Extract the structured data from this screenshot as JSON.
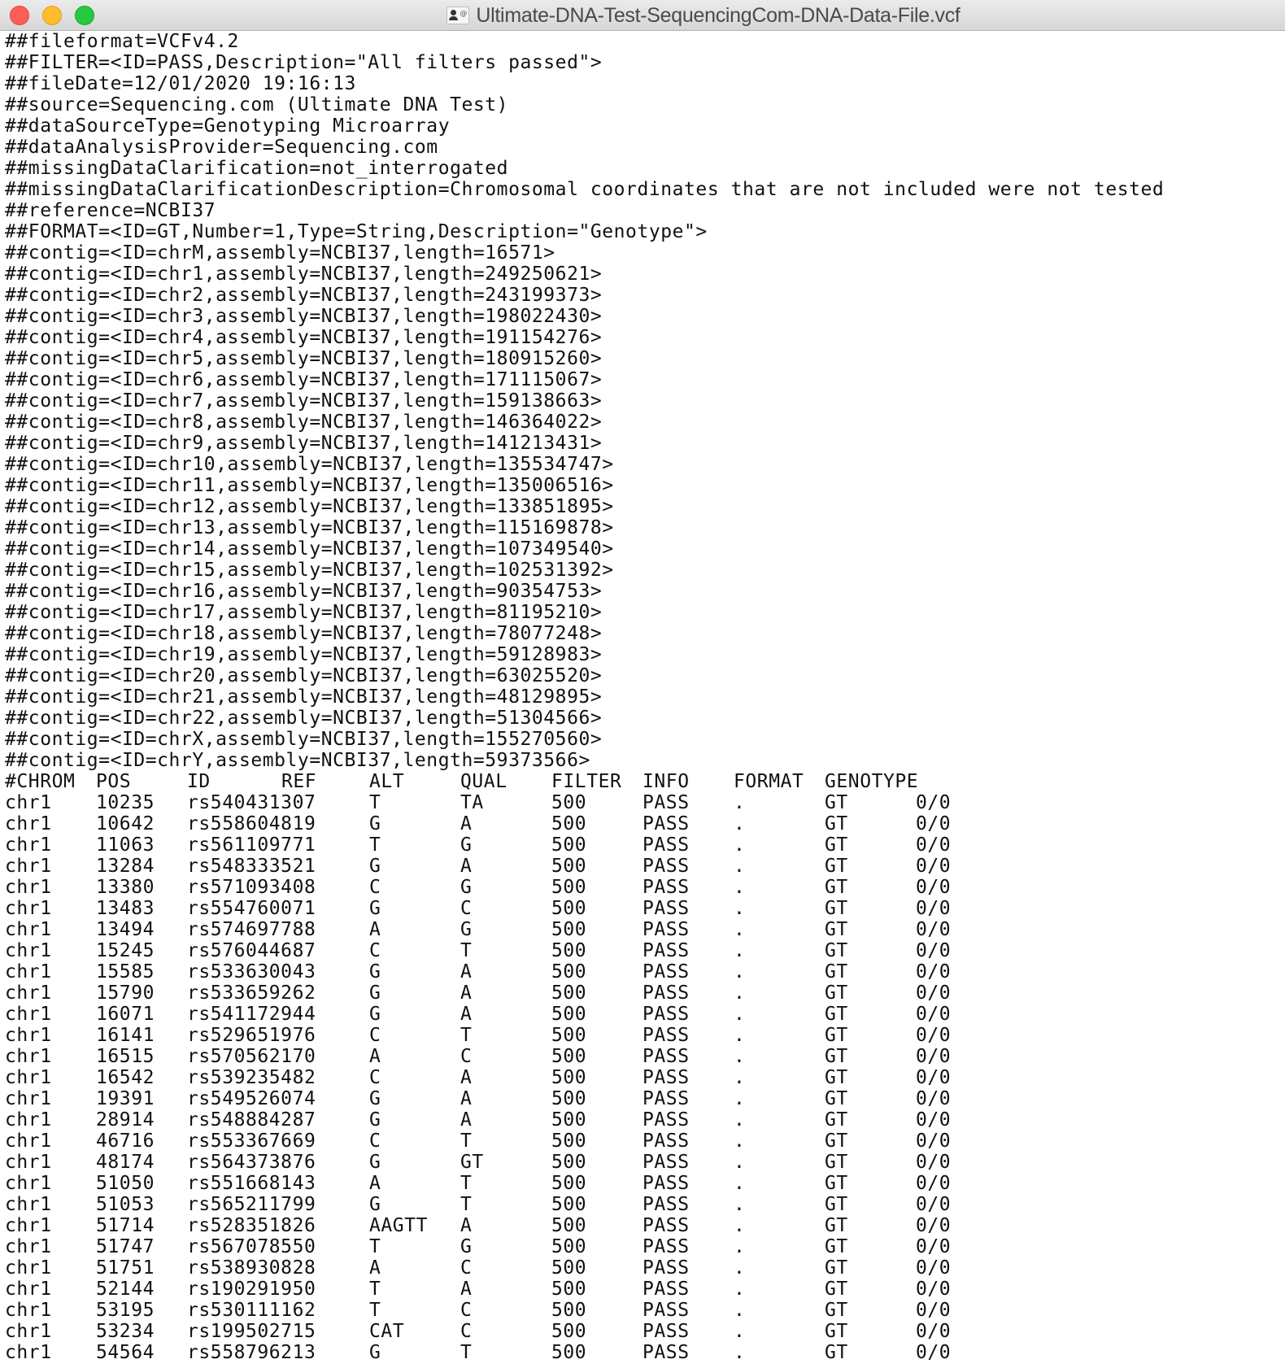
{
  "window": {
    "title": "Ultimate-DNA-Test-SequencingCom-DNA-Data-File.vcf",
    "title_icon": "document-proxy-icon",
    "buttons": {
      "close": "close",
      "minimize": "minimize",
      "zoom": "zoom"
    },
    "colors": {
      "close": "#fd5e57",
      "minimize": "#febc2e",
      "zoom": "#28c840"
    }
  },
  "header_lines": [
    "##fileformat=VCFv4.2",
    "##FILTER=<ID=PASS,Description=\"All filters passed\">",
    "##fileDate=12/01/2020 19:16:13",
    "##source=Sequencing.com (Ultimate DNA Test)",
    "##dataSourceType=Genotyping Microarray",
    "##dataAnalysisProvider=Sequencing.com",
    "##missingDataClarification=not_interrogated",
    "##missingDataClarificationDescription=Chromosomal coordinates that are not included were not tested",
    "##reference=NCBI37",
    "##FORMAT=<ID=GT,Number=1,Type=String,Description=\"Genotype\">",
    "##contig=<ID=chrM,assembly=NCBI37,length=16571>",
    "##contig=<ID=chr1,assembly=NCBI37,length=249250621>",
    "##contig=<ID=chr2,assembly=NCBI37,length=243199373>",
    "##contig=<ID=chr3,assembly=NCBI37,length=198022430>",
    "##contig=<ID=chr4,assembly=NCBI37,length=191154276>",
    "##contig=<ID=chr5,assembly=NCBI37,length=180915260>",
    "##contig=<ID=chr6,assembly=NCBI37,length=171115067>",
    "##contig=<ID=chr7,assembly=NCBI37,length=159138663>",
    "##contig=<ID=chr8,assembly=NCBI37,length=146364022>",
    "##contig=<ID=chr9,assembly=NCBI37,length=141213431>",
    "##contig=<ID=chr10,assembly=NCBI37,length=135534747>",
    "##contig=<ID=chr11,assembly=NCBI37,length=135006516>",
    "##contig=<ID=chr12,assembly=NCBI37,length=133851895>",
    "##contig=<ID=chr13,assembly=NCBI37,length=115169878>",
    "##contig=<ID=chr14,assembly=NCBI37,length=107349540>",
    "##contig=<ID=chr15,assembly=NCBI37,length=102531392>",
    "##contig=<ID=chr16,assembly=NCBI37,length=90354753>",
    "##contig=<ID=chr17,assembly=NCBI37,length=81195210>",
    "##contig=<ID=chr18,assembly=NCBI37,length=78077248>",
    "##contig=<ID=chr19,assembly=NCBI37,length=59128983>",
    "##contig=<ID=chr20,assembly=NCBI37,length=63025520>",
    "##contig=<ID=chr21,assembly=NCBI37,length=48129895>",
    "##contig=<ID=chr22,assembly=NCBI37,length=51304566>",
    "##contig=<ID=chrX,assembly=NCBI37,length=155270560>",
    "##contig=<ID=chrY,assembly=NCBI37,length=59373566>"
  ],
  "columns": [
    "#CHROM",
    "POS",
    "ID",
    "REF",
    "ALT",
    "QUAL",
    "FILTER",
    "INFO",
    "FORMAT",
    "GENOTYPE"
  ],
  "rows": [
    [
      "chr1",
      "10235",
      "rs540431307",
      "T",
      "TA",
      "500",
      "PASS",
      ".",
      "GT",
      "0/0"
    ],
    [
      "chr1",
      "10642",
      "rs558604819",
      "G",
      "A",
      "500",
      "PASS",
      ".",
      "GT",
      "0/0"
    ],
    [
      "chr1",
      "11063",
      "rs561109771",
      "T",
      "G",
      "500",
      "PASS",
      ".",
      "GT",
      "0/0"
    ],
    [
      "chr1",
      "13284",
      "rs548333521",
      "G",
      "A",
      "500",
      "PASS",
      ".",
      "GT",
      "0/0"
    ],
    [
      "chr1",
      "13380",
      "rs571093408",
      "C",
      "G",
      "500",
      "PASS",
      ".",
      "GT",
      "0/0"
    ],
    [
      "chr1",
      "13483",
      "rs554760071",
      "G",
      "C",
      "500",
      "PASS",
      ".",
      "GT",
      "0/0"
    ],
    [
      "chr1",
      "13494",
      "rs574697788",
      "A",
      "G",
      "500",
      "PASS",
      ".",
      "GT",
      "0/0"
    ],
    [
      "chr1",
      "15245",
      "rs576044687",
      "C",
      "T",
      "500",
      "PASS",
      ".",
      "GT",
      "0/0"
    ],
    [
      "chr1",
      "15585",
      "rs533630043",
      "G",
      "A",
      "500",
      "PASS",
      ".",
      "GT",
      "0/0"
    ],
    [
      "chr1",
      "15790",
      "rs533659262",
      "G",
      "A",
      "500",
      "PASS",
      ".",
      "GT",
      "0/0"
    ],
    [
      "chr1",
      "16071",
      "rs541172944",
      "G",
      "A",
      "500",
      "PASS",
      ".",
      "GT",
      "0/0"
    ],
    [
      "chr1",
      "16141",
      "rs529651976",
      "C",
      "T",
      "500",
      "PASS",
      ".",
      "GT",
      "0/0"
    ],
    [
      "chr1",
      "16515",
      "rs570562170",
      "A",
      "C",
      "500",
      "PASS",
      ".",
      "GT",
      "0/0"
    ],
    [
      "chr1",
      "16542",
      "rs539235482",
      "C",
      "A",
      "500",
      "PASS",
      ".",
      "GT",
      "0/0"
    ],
    [
      "chr1",
      "19391",
      "rs549526074",
      "G",
      "A",
      "500",
      "PASS",
      ".",
      "GT",
      "0/0"
    ],
    [
      "chr1",
      "28914",
      "rs548884287",
      "G",
      "A",
      "500",
      "PASS",
      ".",
      "GT",
      "0/0"
    ],
    [
      "chr1",
      "46716",
      "rs553367669",
      "C",
      "T",
      "500",
      "PASS",
      ".",
      "GT",
      "0/0"
    ],
    [
      "chr1",
      "48174",
      "rs564373876",
      "G",
      "GT",
      "500",
      "PASS",
      ".",
      "GT",
      "0/0"
    ],
    [
      "chr1",
      "51050",
      "rs551668143",
      "A",
      "T",
      "500",
      "PASS",
      ".",
      "GT",
      "0/0"
    ],
    [
      "chr1",
      "51053",
      "rs565211799",
      "G",
      "T",
      "500",
      "PASS",
      ".",
      "GT",
      "0/0"
    ],
    [
      "chr1",
      "51714",
      "rs528351826",
      "AAGTT",
      "A",
      "500",
      "PASS",
      ".",
      "GT",
      "0/0"
    ],
    [
      "chr1",
      "51747",
      "rs567078550",
      "T",
      "G",
      "500",
      "PASS",
      ".",
      "GT",
      "0/0"
    ],
    [
      "chr1",
      "51751",
      "rs538930828",
      "A",
      "C",
      "500",
      "PASS",
      ".",
      "GT",
      "0/0"
    ],
    [
      "chr1",
      "52144",
      "rs190291950",
      "T",
      "A",
      "500",
      "PASS",
      ".",
      "GT",
      "0/0"
    ],
    [
      "chr1",
      "53195",
      "rs530111162",
      "T",
      "C",
      "500",
      "PASS",
      ".",
      "GT",
      "0/0"
    ],
    [
      "chr1",
      "53234",
      "rs199502715",
      "CAT",
      "C",
      "500",
      "PASS",
      ".",
      "GT",
      "0/0"
    ],
    [
      "chr1",
      "54564",
      "rs558796213",
      "G",
      "T",
      "500",
      "PASS",
      ".",
      "GT",
      "0/0"
    ]
  ]
}
